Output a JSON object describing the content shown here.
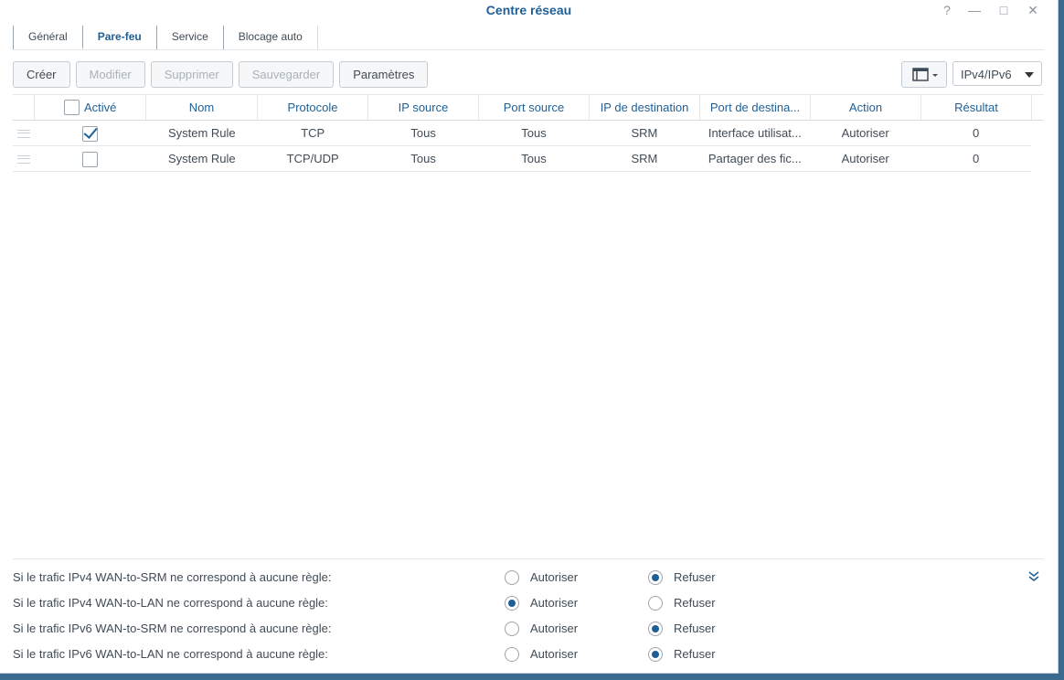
{
  "window": {
    "title": "Centre réseau",
    "help": "?",
    "minimize": "—",
    "maximize": "□",
    "close": "✕"
  },
  "tabs": [
    "Général",
    "Pare-feu",
    "Service",
    "Blocage auto"
  ],
  "toolbar": {
    "create": "Créer",
    "modify": "Modifier",
    "delete": "Supprimer",
    "save": "Sauvegarder",
    "settings": "Paramètres",
    "ip_filter": "IPv4/IPv6"
  },
  "table": {
    "columns": [
      "Activé",
      "Nom",
      "Protocole",
      "IP source",
      "Port source",
      "IP de destination",
      "Port de destina...",
      "Action",
      "Résultat"
    ],
    "rows": [
      {
        "enabled": true,
        "name": "System Rule",
        "protocol": "TCP",
        "src_ip": "Tous",
        "src_port": "Tous",
        "dst_ip": "SRM",
        "dst_port": "Interface utilisat...",
        "action": "Autoriser",
        "result": "0"
      },
      {
        "enabled": false,
        "name": "System Rule",
        "protocol": "TCP/UDP",
        "src_ip": "Tous",
        "src_port": "Tous",
        "dst_ip": "SRM",
        "dst_port": "Partager des fic...",
        "action": "Autoriser",
        "result": "0"
      }
    ]
  },
  "policies": {
    "allow_label": "Autoriser",
    "deny_label": "Refuser",
    "items": [
      {
        "text": "Si le trafic IPv4 WAN-to-SRM ne correspond à aucune règle:",
        "selected": "deny"
      },
      {
        "text": "Si le trafic IPv4 WAN-to-LAN ne correspond à aucune règle:",
        "selected": "allow"
      },
      {
        "text": "Si le trafic IPv6 WAN-to-SRM ne correspond à aucune règle:",
        "selected": "deny"
      },
      {
        "text": "Si le trafic IPv6 WAN-to-LAN ne correspond à aucune règle:",
        "selected": "deny"
      }
    ]
  },
  "icons": {
    "expand": "chevron-double-down-icon",
    "view": "layout-icon"
  }
}
